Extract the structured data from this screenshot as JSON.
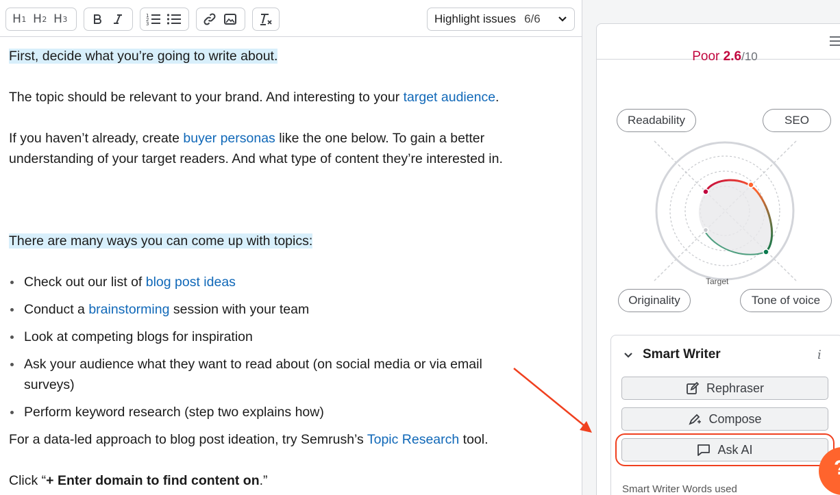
{
  "toolbar": {
    "headings": [
      {
        "label": "H",
        "sub": "1"
      },
      {
        "label": "H",
        "sub": "2"
      },
      {
        "label": "H",
        "sub": "3"
      }
    ],
    "highlight": {
      "label": "Highlight issues",
      "count": "6/6"
    }
  },
  "content": {
    "p1": "First, decide what you’re going to write about.",
    "p2_a": "The topic should be relevant to your brand. And interesting to your ",
    "p2_link": "target audience",
    "p2_b": ".",
    "p3_a": "If you haven’t already, create ",
    "p3_link": "buyer personas",
    "p3_b": " like the one below. To gain a better understanding of your target readers. And what type of content they’re interested in.",
    "p4": "There are many ways you can come up with topics:",
    "b1_a": "Check out our list of ",
    "b1_link": "blog post ideas",
    "b2_a": "Conduct a ",
    "b2_link": "brainstorming",
    "b2_b": " session with your team",
    "b3": "Look at competing blogs for inspiration",
    "b4": "Ask your audience what they want to read about (on social media or via email surveys)",
    "b5": "Perform keyword research (step two explains how)",
    "p5_a": "For a data-led approach to blog post ideation, try Semrush’s ",
    "p5_link": "Topic Research",
    "p5_b": " tool.",
    "p6_a": "Click “",
    "p6_bold": "+ Enter domain to find content on",
    "p6_b": ".”"
  },
  "score": {
    "label": "Poor",
    "value": "2.6",
    "max": "/10"
  },
  "metrics": {
    "readability": "Readability",
    "seo": "SEO",
    "originality": "Originality",
    "tone": "Tone of voice",
    "target": "Target"
  },
  "smart_writer": {
    "title": "Smart Writer",
    "info": "i",
    "rephraser": "Rephraser",
    "compose": "Compose",
    "ask_ai": "Ask AI",
    "footer": "Smart Writer Words used"
  },
  "fab": {
    "label": "?"
  },
  "colors": {
    "link": "#1068b8",
    "highlight": "#d8effb",
    "score": "#c1063e",
    "annotation": "#f0401f",
    "fab": "#ff642d"
  }
}
